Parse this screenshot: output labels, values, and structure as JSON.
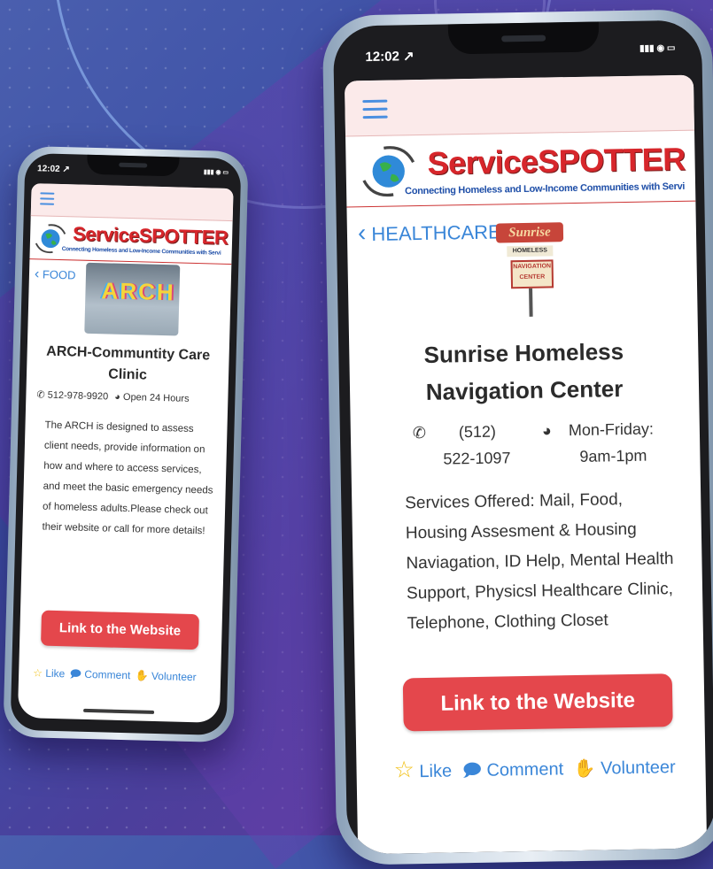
{
  "colors": {
    "accent": "#e4474c",
    "link": "#3a86d8",
    "brand_red": "#d7262b",
    "brand_blue": "#1f4fa8"
  },
  "left_phone": {
    "status_time": "12:02",
    "status_icons": "▮▮▮ ◉ ▭",
    "brand": {
      "title": "ServiceSPOTTER",
      "subtitle": "Connecting Homeless and Low-Income Communities with Servi"
    },
    "back_label": "FOOD",
    "photo_text": "ARCH",
    "title": "ARCH-Communtity Care Clinic",
    "phone": "512-978-9920",
    "hours": "Open 24 Hours",
    "description": "The ARCH is designed to assess client needs, provide information on how and where to access services, and meet the basic emergency needs of homeless adults.Please check out their website or call for more details!",
    "button": "Link to the Website",
    "actions": {
      "like": "Like",
      "comment": "Comment",
      "volunteer": "Volunteer"
    }
  },
  "right_phone": {
    "status_time": "12:02",
    "status_icons": "▮▮▮ ◉ ▭",
    "brand": {
      "title": "ServiceSPOTTER",
      "subtitle": "Connecting Homeless and Low-Income Communities with Servi"
    },
    "back_label": "HEALTHCARE",
    "sign": {
      "top": "Sunrise",
      "middle": "HOMELESS",
      "bottom1": "NAVIGATION",
      "bottom2": "CENTER"
    },
    "title_line1": "Sunrise Homeless",
    "title_line2": "Navigation Center",
    "phone_line1": "(512)",
    "phone_line2": "522-1097",
    "hours_line1": "Mon-Friday:",
    "hours_line2": "9am-1pm",
    "description": "Services Offered: Mail, Food, Housing Assesment & Housing Naviagation, ID Help, Mental Health Support, Physicsl Healthcare Clinic, Telephone, Clothing Closet",
    "button": "Link to the Website",
    "actions": {
      "like": "Like",
      "comment": "Comment",
      "volunteer": "Volunteer"
    }
  },
  "icons": [
    "menu-icon",
    "globe-hands-logo-icon",
    "chevron-left-icon",
    "phone-icon",
    "clock-icon",
    "star-icon",
    "comment-icon",
    "hand-icon",
    "signal-icon",
    "wifi-icon",
    "battery-icon",
    "location-arrow-icon"
  ]
}
